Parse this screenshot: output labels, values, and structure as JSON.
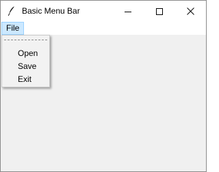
{
  "window": {
    "title": "Basic Menu Bar",
    "title_icon": "feather-icon",
    "controls": {
      "minimize_icon": "minimize-icon",
      "maximize_icon": "maximize-icon",
      "close_icon": "close-icon"
    }
  },
  "menubar": {
    "menus": [
      {
        "label": "File",
        "active": true
      }
    ]
  },
  "file_menu": {
    "tearoff": true,
    "items": [
      {
        "label": "Open"
      },
      {
        "label": "Save"
      },
      {
        "label": "Exit"
      }
    ]
  },
  "colors": {
    "menu_highlight": "#cce8ff",
    "menu_highlight_border": "#99d1ff",
    "client_background": "#f0f0f0"
  }
}
